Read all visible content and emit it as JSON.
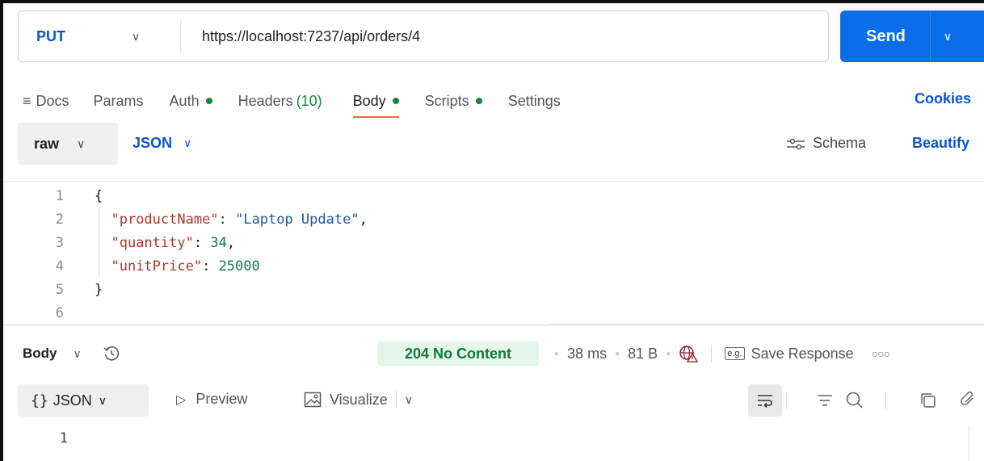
{
  "request": {
    "method": "PUT",
    "url": "https://localhost:7237/api/orders/4",
    "send_label": "Send"
  },
  "tabs": [
    {
      "label": "Docs",
      "dot": false
    },
    {
      "label": "Params",
      "dot": false
    },
    {
      "label": "Auth",
      "dot": true
    },
    {
      "label": "Headers",
      "count": "(10)",
      "dot": false
    },
    {
      "label": "Body",
      "dot": true,
      "active": true
    },
    {
      "label": "Scripts",
      "dot": true
    },
    {
      "label": "Settings",
      "dot": false
    }
  ],
  "cookies_label": "Cookies",
  "body_mode": {
    "raw_label": "raw",
    "format_label": "JSON",
    "schema_label": "Schema",
    "beautify_label": "Beautify"
  },
  "editor": {
    "line_numbers": [
      "1",
      "2",
      "3",
      "4",
      "5",
      "6"
    ],
    "open_brace": "{",
    "close_brace": "}",
    "fields": [
      {
        "key": "\"productName\"",
        "value": "\"Laptop Update\"",
        "type": "string",
        "trail": ","
      },
      {
        "key": "\"quantity\"",
        "value": "34",
        "type": "number",
        "trail": ","
      },
      {
        "key": "\"unitPrice\"",
        "value": "25000",
        "type": "number",
        "trail": ""
      }
    ]
  },
  "response": {
    "section_label": "Body",
    "status": "204 No Content",
    "time": "38 ms",
    "size": "81 B",
    "eg_label": "e.g.",
    "save_label": "Save Response",
    "format_label": "JSON",
    "preview_label": "Preview",
    "visualize_label": "Visualize",
    "line_numbers": [
      "1"
    ]
  },
  "colors": {
    "accent_blue": "#0a6ee8",
    "link_blue": "#0a55c7",
    "status_green": "#0f7a3a",
    "active_tab_underline": "#f26b3a"
  }
}
